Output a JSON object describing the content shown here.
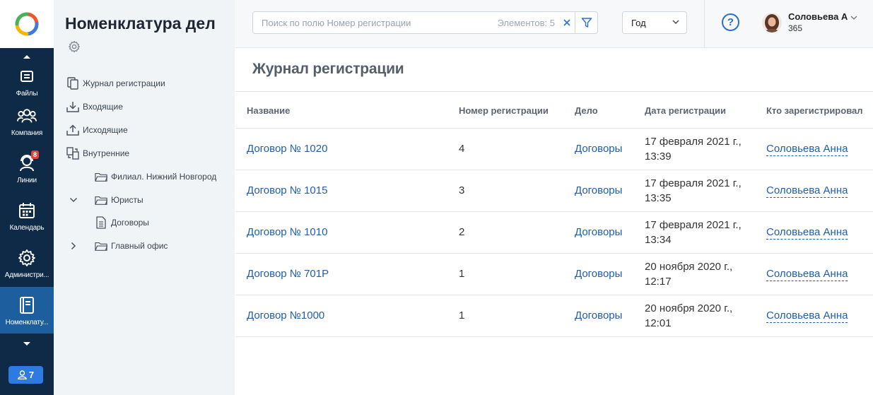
{
  "rail": {
    "items": [
      {
        "label": "Файлы",
        "icon": "files-icon"
      },
      {
        "label": "Компания",
        "icon": "company-icon"
      },
      {
        "label": "Линии",
        "icon": "lines-icon",
        "badge": "8"
      },
      {
        "label": "Календарь",
        "icon": "calendar-icon"
      },
      {
        "label": "Администри...",
        "icon": "admin-gear-icon"
      },
      {
        "label": "Номенклату...",
        "icon": "nomenclature-book-icon",
        "active": true
      }
    ],
    "users_count": "7"
  },
  "sidebar": {
    "title": "Номенклатура дел",
    "tree": [
      {
        "label": "Журнал регистрации",
        "icon": "copy-docs-icon"
      },
      {
        "label": "Входящие",
        "icon": "inbox-download-icon"
      },
      {
        "label": "Исходящие",
        "icon": "outbox-upload-icon"
      },
      {
        "label": "Внутренние",
        "icon": "internal-transfer-icon"
      },
      {
        "label": "Филиал. Нижний Новгород",
        "icon": "folder-icon"
      },
      {
        "label": "Юристы",
        "icon": "folder-icon",
        "expanded": true
      },
      {
        "label": "Договоры",
        "icon": "document-icon"
      },
      {
        "label": "Главный офис",
        "icon": "folder-icon",
        "expanded": false
      }
    ]
  },
  "header": {
    "search_placeholder": "Поиск по полю Номер регистрации",
    "elements_count": "Элементов: 5",
    "period": "Год",
    "user_name": "Соловьева А",
    "user_sub": "365"
  },
  "main": {
    "title": "Журнал регистрации",
    "columns": [
      "Название",
      "Номер регистрации",
      "Дело",
      "Дата регистрации",
      "Кто зарегистрировал"
    ],
    "rows": [
      {
        "name": "Договор № 1020",
        "number": "4",
        "case": "Договоры",
        "date": "17 февраля 2021 г.,",
        "time": "13:39",
        "user": "Соловьева Анна"
      },
      {
        "name": "Договор № 1015",
        "number": "3",
        "case": "Договоры",
        "date": "17 февраля 2021 г.,",
        "time": "13:35",
        "user": "Соловьева Анна"
      },
      {
        "name": "Договор № 1010",
        "number": "2",
        "case": "Договоры",
        "date": "17 февраля 2021 г.,",
        "time": "13:34",
        "user": "Соловьева Анна"
      },
      {
        "name": "Договор № 701Р",
        "number": "1",
        "case": "Договоры",
        "date": "20 ноября 2020 г.,",
        "time": "12:17",
        "user": "Соловьева Анна"
      },
      {
        "name": "Договор №1000",
        "number": "1",
        "case": "Договоры",
        "date": "20 ноября 2020 г.,",
        "time": "12:01",
        "user": "Соловьева Анна"
      }
    ]
  },
  "colors": {
    "rail_bg": "#0e2a47",
    "rail_active": "#1d5f9e",
    "link": "#1f5eac",
    "sidebar_bg": "#f1f4f7"
  }
}
